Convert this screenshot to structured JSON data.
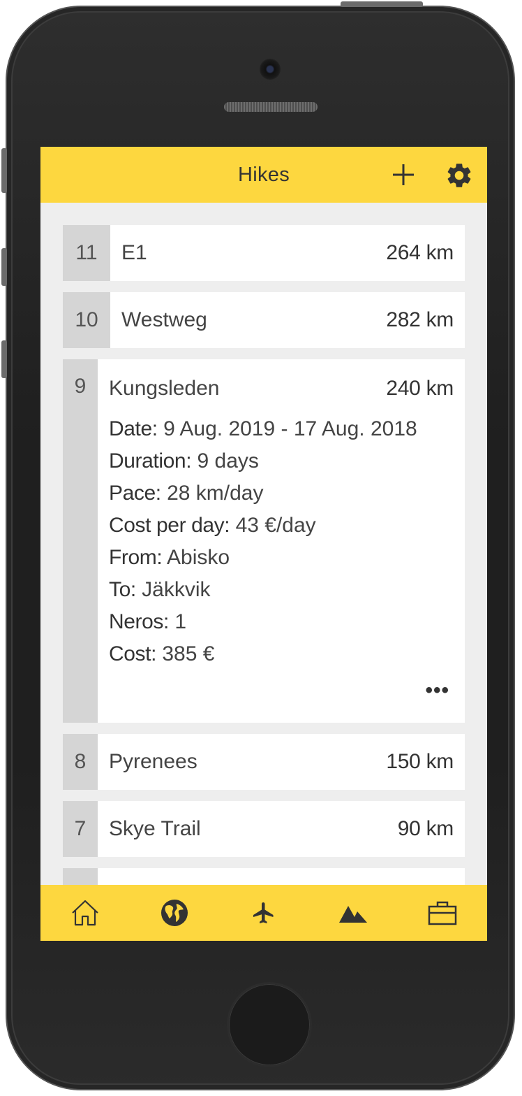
{
  "header": {
    "title": "Hikes",
    "add_icon": "plus-icon",
    "settings_icon": "gear-icon"
  },
  "hikes": [
    {
      "num": "11",
      "name": "E1",
      "distance": "264 km"
    },
    {
      "num": "10",
      "name": "Westweg",
      "distance": "282 km"
    },
    {
      "num": "9",
      "name": "Kungsleden",
      "distance": "240 km",
      "details": {
        "date_label": "Date:",
        "date": "9 Aug. 2019 - 17 Aug. 2018",
        "duration_label": "Duration:",
        "duration": "9 days",
        "pace_label": "Pace:",
        "pace": "28 km/day",
        "cost_per_day_label": "Cost per day:",
        "cost_per_day": "43 €/day",
        "from_label": "From:",
        "from": "Abisko",
        "to_label": "To:",
        "to": "Jäkkvik",
        "neros_label": "Neros:",
        "neros": "1",
        "cost_label": "Cost:",
        "cost": "385 €"
      },
      "more": "•••"
    },
    {
      "num": "8",
      "name": "Pyrenees",
      "distance": "150 km"
    },
    {
      "num": "7",
      "name": "Skye Trail",
      "distance": "90 km"
    }
  ],
  "bottom_nav": [
    "home-icon",
    "globe-icon",
    "airplane-icon",
    "mountains-icon",
    "briefcase-icon"
  ],
  "colors": {
    "accent": "#fdd73f",
    "number_bg": "#d5d5d5",
    "screen_bg": "#eeeeee",
    "text": "#333333"
  }
}
